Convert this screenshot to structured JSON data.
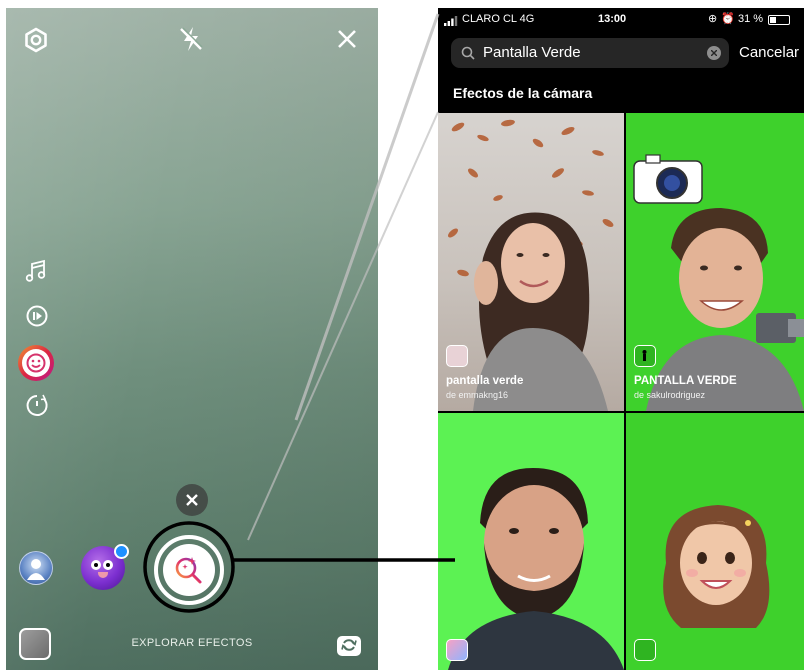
{
  "camera": {
    "explore_label": "EXPLORAR EFECTOS",
    "icons": [
      "settings-icon",
      "flash-off-icon",
      "close-icon",
      "music-icon",
      "boomerang-icon",
      "face-effect-icon",
      "timer-icon",
      "dismiss-icon",
      "effect-search-icon",
      "flip-camera-icon"
    ]
  },
  "phone": {
    "status": {
      "carrier": "CLARO CL 4G",
      "time": "13:00",
      "battery": "31 %"
    },
    "search": {
      "value": "Pantalla Verde",
      "cancel_label": "Cancelar"
    },
    "section_title": "Efectos de la cámara",
    "effects": [
      {
        "name": "pantalla verde",
        "author": "de emmakng16"
      },
      {
        "name": "PANTALLA VERDE",
        "author": "de sakulrodriguez"
      },
      {
        "name": "",
        "author": ""
      },
      {
        "name": "",
        "author": ""
      }
    ]
  },
  "colors": {
    "green_screen": "#3ed12c",
    "bright_green": "#5cf253",
    "camera_bg": "#7f9b89"
  }
}
